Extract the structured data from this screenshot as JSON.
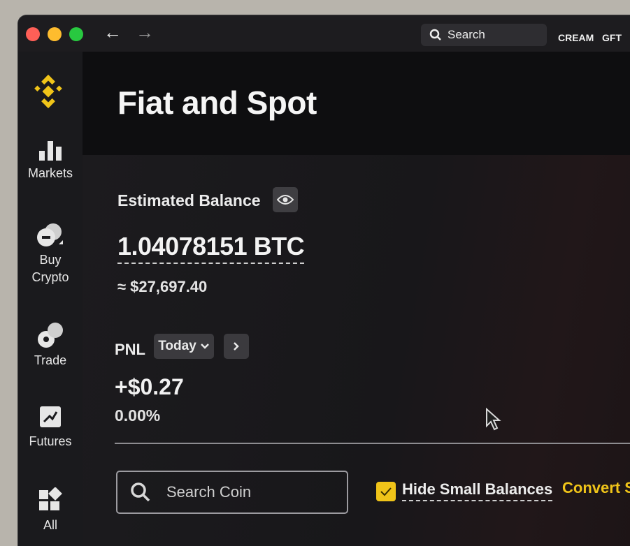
{
  "titlebar": {
    "search_label": "Search",
    "tickers": [
      "CREAM",
      "GFT"
    ]
  },
  "sidebar": {
    "items": [
      {
        "label": "Markets",
        "icon": "bar-chart-icon"
      },
      {
        "label": "Buy Crypto",
        "icon": "coins-icon"
      },
      {
        "label": "Trade",
        "icon": "trade-icon"
      },
      {
        "label": "Futures",
        "icon": "futures-icon"
      },
      {
        "label": "All",
        "icon": "grid-icon"
      }
    ]
  },
  "header": {
    "title": "Fiat and Spot"
  },
  "balance": {
    "label": "Estimated Balance",
    "value": "1.04078151 BTC",
    "fiat_equiv": "≈ $27,697.40"
  },
  "pnl": {
    "label": "PNL",
    "period": "Today",
    "value": "+$0.27",
    "percent": "0.00%"
  },
  "filters": {
    "search_placeholder": "Search Coin",
    "hide_small_label": "Hide Small Balances",
    "hide_small_checked": true,
    "convert_label": "Convert Sm"
  },
  "colors": {
    "accent": "#f0c419",
    "background": "#17171a"
  }
}
